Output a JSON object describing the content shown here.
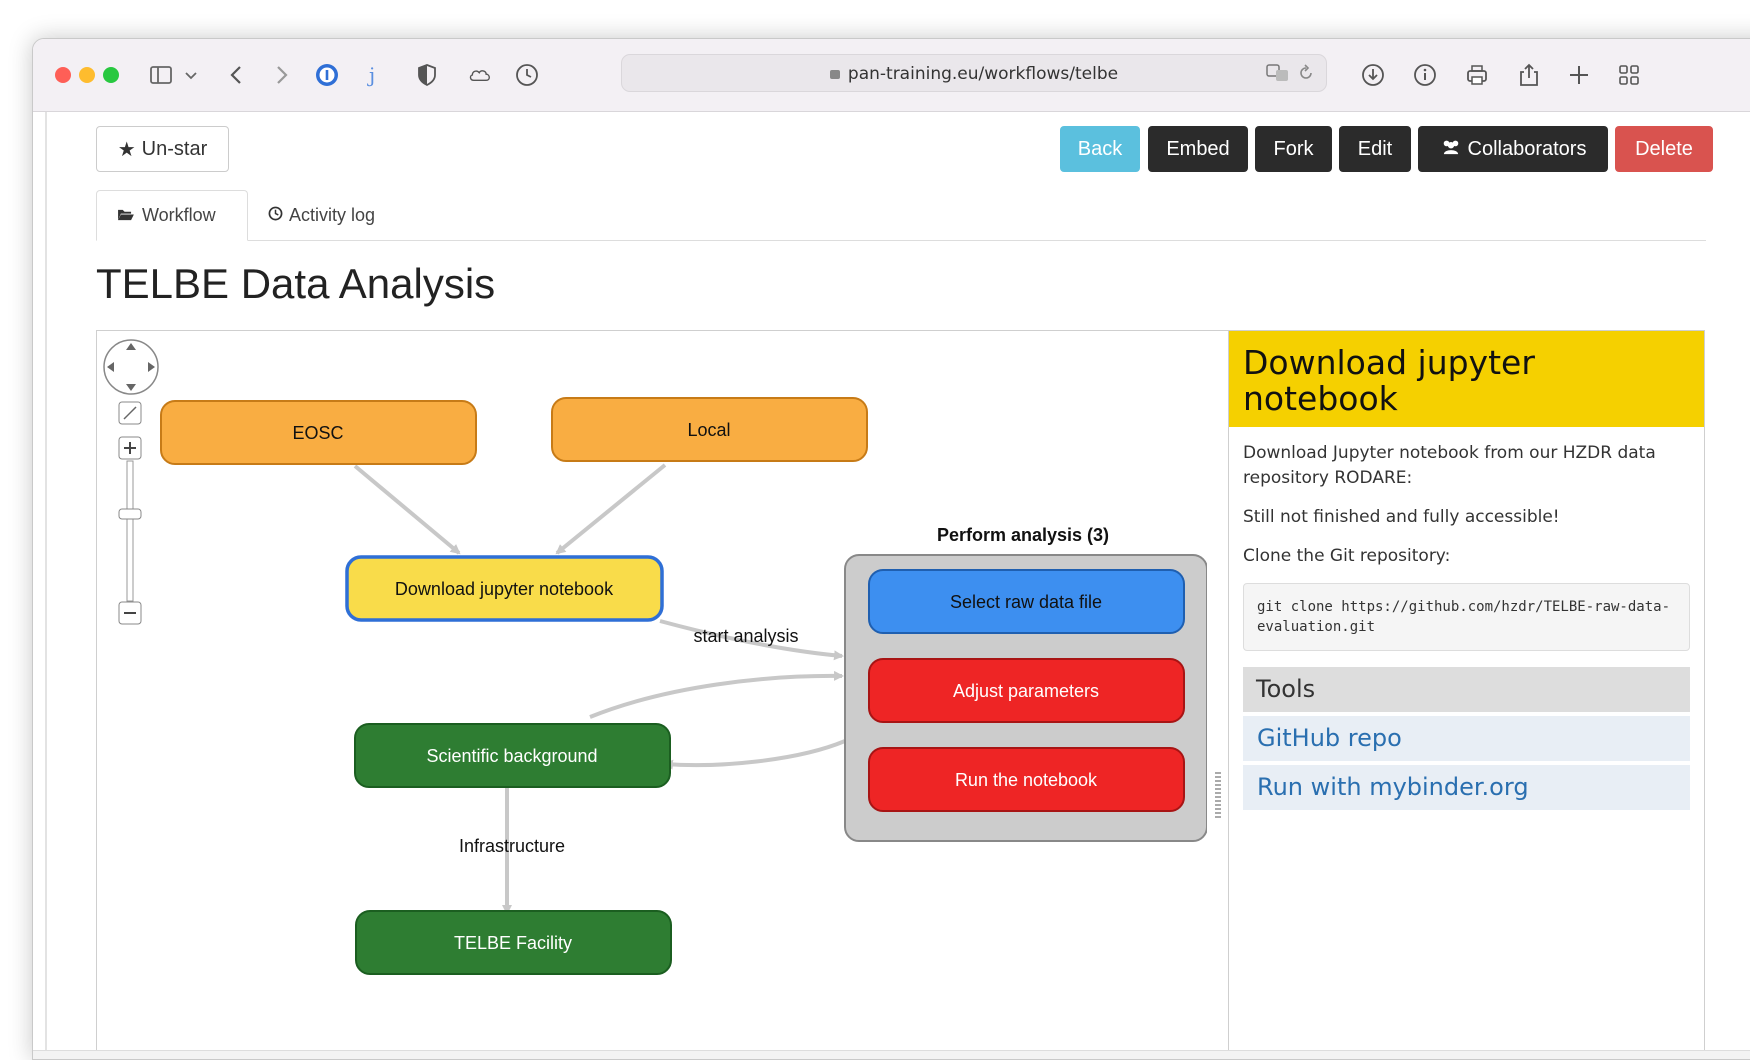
{
  "browser": {
    "url": "pan-training.eu/workflows/telbe"
  },
  "toolbar": {
    "unstar_label": "Un-star",
    "back_label": "Back",
    "embed_label": "Embed",
    "fork_label": "Fork",
    "edit_label": "Edit",
    "collaborators_label": "Collaborators",
    "delete_label": "Delete"
  },
  "tabs": [
    {
      "label": "Workflow",
      "icon": "folder-open-icon",
      "active": true
    },
    {
      "label": "Activity log",
      "icon": "clock-icon",
      "active": false
    }
  ],
  "page_title": "TELBE Data Analysis",
  "workflow": {
    "nodes": {
      "eosc": "EOSC",
      "local": "Local",
      "download": "Download jupyter notebook",
      "scientific": "Scientific background",
      "telbe": "TELBE Facility",
      "select_raw": "Select raw data file",
      "adjust": "Adjust parameters",
      "run": "Run the notebook"
    },
    "group_label": "Perform analysis  (3)",
    "edges": {
      "start_analysis": "start analysis",
      "infrastructure": "Infrastructure"
    },
    "colors": {
      "orange": "#f9ad42",
      "yellow": "#f9dc4a",
      "selected_border": "#2f6fd6",
      "green": "#2e7d32",
      "blue": "#3d8ff0",
      "red": "#ee2525",
      "group_bg": "#cccccc"
    }
  },
  "panel": {
    "title": "Download jupyter notebook",
    "description": "Download Jupyter notebook from our HZDR data repository RODARE:",
    "note": "Still not finished and fully accessible!",
    "clone_label": "Clone the Git repository:",
    "code": "git clone https://github.com/hzdr/TELBE-raw-data-evaluation.git",
    "tools_heading": "Tools",
    "tools": [
      "GitHub repo",
      "Run with mybinder.org"
    ]
  }
}
